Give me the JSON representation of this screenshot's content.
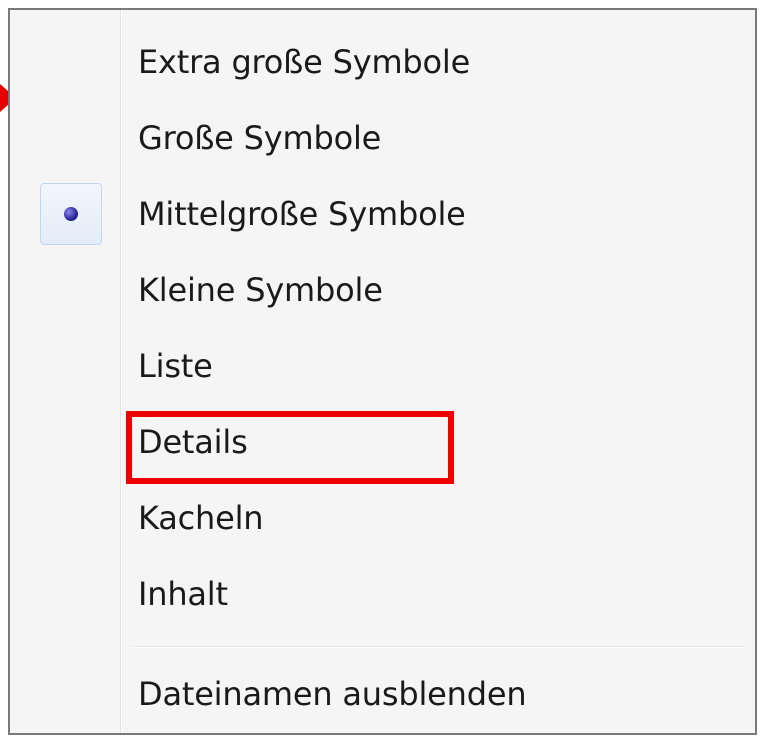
{
  "menu": {
    "items": [
      {
        "label": "Extra große Symbole"
      },
      {
        "label": "Große Symbole"
      },
      {
        "label": "Mittelgroße Symbole",
        "selected": true
      },
      {
        "label": "Kleine Symbole"
      },
      {
        "label": "Liste"
      },
      {
        "label": "Details",
        "highlighted": true
      },
      {
        "label": "Kacheln"
      },
      {
        "label": "Inhalt"
      }
    ],
    "footer_item": {
      "label": "Dateinamen ausblenden"
    }
  },
  "colors": {
    "highlight_border": "#ef0000",
    "arrow": "#e60000",
    "radio_dot": "#2a249b",
    "menu_background": "#f5f5f5"
  },
  "icons": {
    "selected_indicator": "radio-bullet-icon",
    "callout_arrow": "arrow-pointer-icon"
  }
}
